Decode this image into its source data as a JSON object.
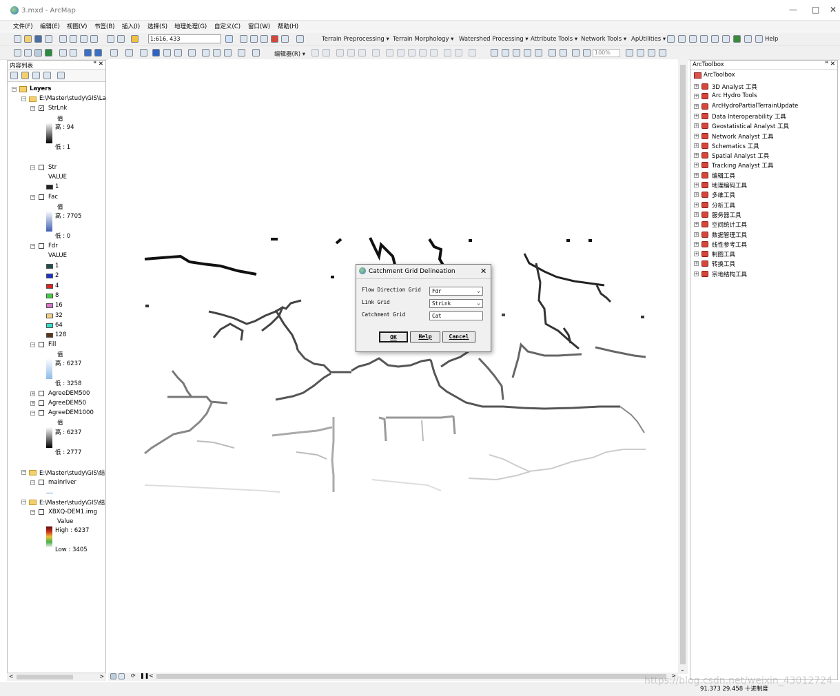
{
  "window": {
    "title": "3.mxd - ArcMap"
  },
  "menu": [
    "文件(F)",
    "编辑(E)",
    "视图(V)",
    "书签(B)",
    "插入(I)",
    "选择(S)",
    "地理处理(G)",
    "自定义(C)",
    "窗口(W)",
    "帮助(H)"
  ],
  "toolbar1": {
    "scale": "1:616, 433",
    "menus": [
      "Terrain Preprocessing",
      "Terrain Morphology",
      "Watershed Processing",
      "Attribute Tools",
      "Network Tools",
      "ApUtilities"
    ],
    "help": "Help"
  },
  "toolbar2": {
    "editor": "编辑器(R)",
    "zoom": "100%"
  },
  "toc": {
    "title": "内容列表",
    "layers_root": "Layers",
    "group1": "E:\\Master\\study\\GIS\\La",
    "strlnk": {
      "name": "StrLnk",
      "field": "值",
      "high": "高 : 94",
      "low": "低 : 1"
    },
    "str": {
      "name": "Str",
      "field": "VALUE",
      "v1": "1"
    },
    "fac": {
      "name": "Fac",
      "field": "值",
      "high": "高 : 7705",
      "low": "低 : 0"
    },
    "fdr": {
      "name": "Fdr",
      "field": "VALUE",
      "values": [
        "1",
        "2",
        "4",
        "8",
        "16",
        "32",
        "64",
        "128"
      ],
      "colors": [
        "#1f4e4b",
        "#1f33c8",
        "#e0231e",
        "#3ccf3c",
        "#d975cd",
        "#f5ce82",
        "#2fe0c8",
        "#5a3512"
      ]
    },
    "fill": {
      "name": "Fill",
      "field": "值",
      "high": "高 : 6237",
      "low": "低 : 3258"
    },
    "agree500": "AgreeDEM500",
    "agree50": "AgreeDEM50",
    "agree1000": {
      "name": "AgreeDEM1000",
      "field": "值",
      "high": "高 : 6237",
      "low": "低 : 2777"
    },
    "group2": "E:\\Master\\study\\GIS\\结",
    "mainriver": "mainriver",
    "group3": "E:\\Master\\study\\GIS\\结",
    "dem": {
      "name": "XBXQ-DEM1.img",
      "field": "Value",
      "high": "High : 6237",
      "low": "Low : 3405"
    }
  },
  "toolbox": {
    "title": "ArcToolbox",
    "root": "ArcToolbox",
    "items": [
      "3D Analyst 工具",
      "Arc Hydro Tools",
      "ArcHydroPartialTerrainUpdate",
      "Data Interoperability 工具",
      "Geostatistical Analyst 工具",
      "Network Analyst 工具",
      "Schematics 工具",
      "Spatial Analyst 工具",
      "Tracking Analyst 工具",
      "编辑工具",
      "地理编码工具",
      "多维工具",
      "分析工具",
      "服务器工具",
      "空间统计工具",
      "数据管理工具",
      "线性参考工具",
      "制图工具",
      "转换工具",
      "宗地结构工具"
    ]
  },
  "dialog": {
    "title": "Catchment Grid Delineation",
    "fields": [
      {
        "label": "Flow Direction Grid",
        "value": "Fdr"
      },
      {
        "label": "Link Grid",
        "value": "StrLnk"
      },
      {
        "label": "Catchment Grid",
        "value": "Cat"
      }
    ],
    "ok": "OK",
    "help": "Help",
    "cancel": "Cancel"
  },
  "status": {
    "coords": "91.373  29.458 十进制度",
    "watermark": "https://blog.csdn.net/weixin_43012724"
  }
}
